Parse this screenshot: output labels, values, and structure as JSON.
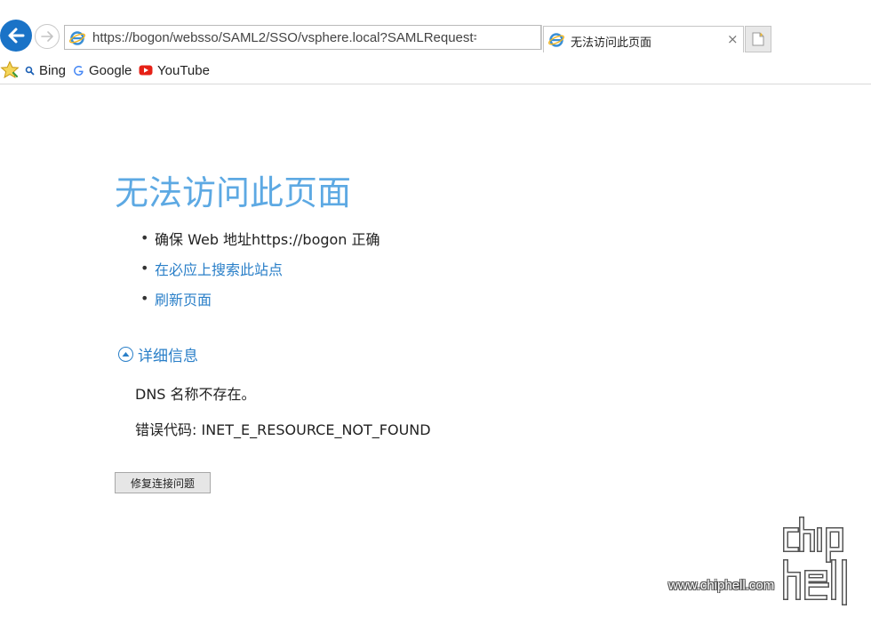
{
  "browser": {
    "address_url": "https://bogon/websso/SAML2/SSO/vsphere.local?SAMLRequest=",
    "tab_title": "无法访问此页面",
    "tab_close": "×"
  },
  "favorites": {
    "items": [
      {
        "label": "Bing",
        "icon": "search-icon"
      },
      {
        "label": "Google",
        "icon": "google-icon"
      },
      {
        "label": "YouTube",
        "icon": "youtube-icon"
      }
    ]
  },
  "error_page": {
    "title": "无法访问此页面",
    "suggestions": [
      {
        "text": "确保 Web 地址https://bogon 正确",
        "is_link": false
      },
      {
        "text": "在必应上搜索此站点",
        "is_link": true
      },
      {
        "text": "刷新页面",
        "is_link": true
      }
    ],
    "details_label": "详细信息",
    "dns_message": "DNS 名称不存在。",
    "error_code": "错误代码: INET_E_RESOURCE_NOT_FOUND",
    "fix_button": "修复连接问题"
  },
  "watermark": {
    "url": "www.chiphell.com",
    "logo_text": "chip hell"
  },
  "colors": {
    "title_blue": "#5da9e3",
    "link_blue": "#2a7fc8",
    "back_button": "#1a73c7"
  }
}
